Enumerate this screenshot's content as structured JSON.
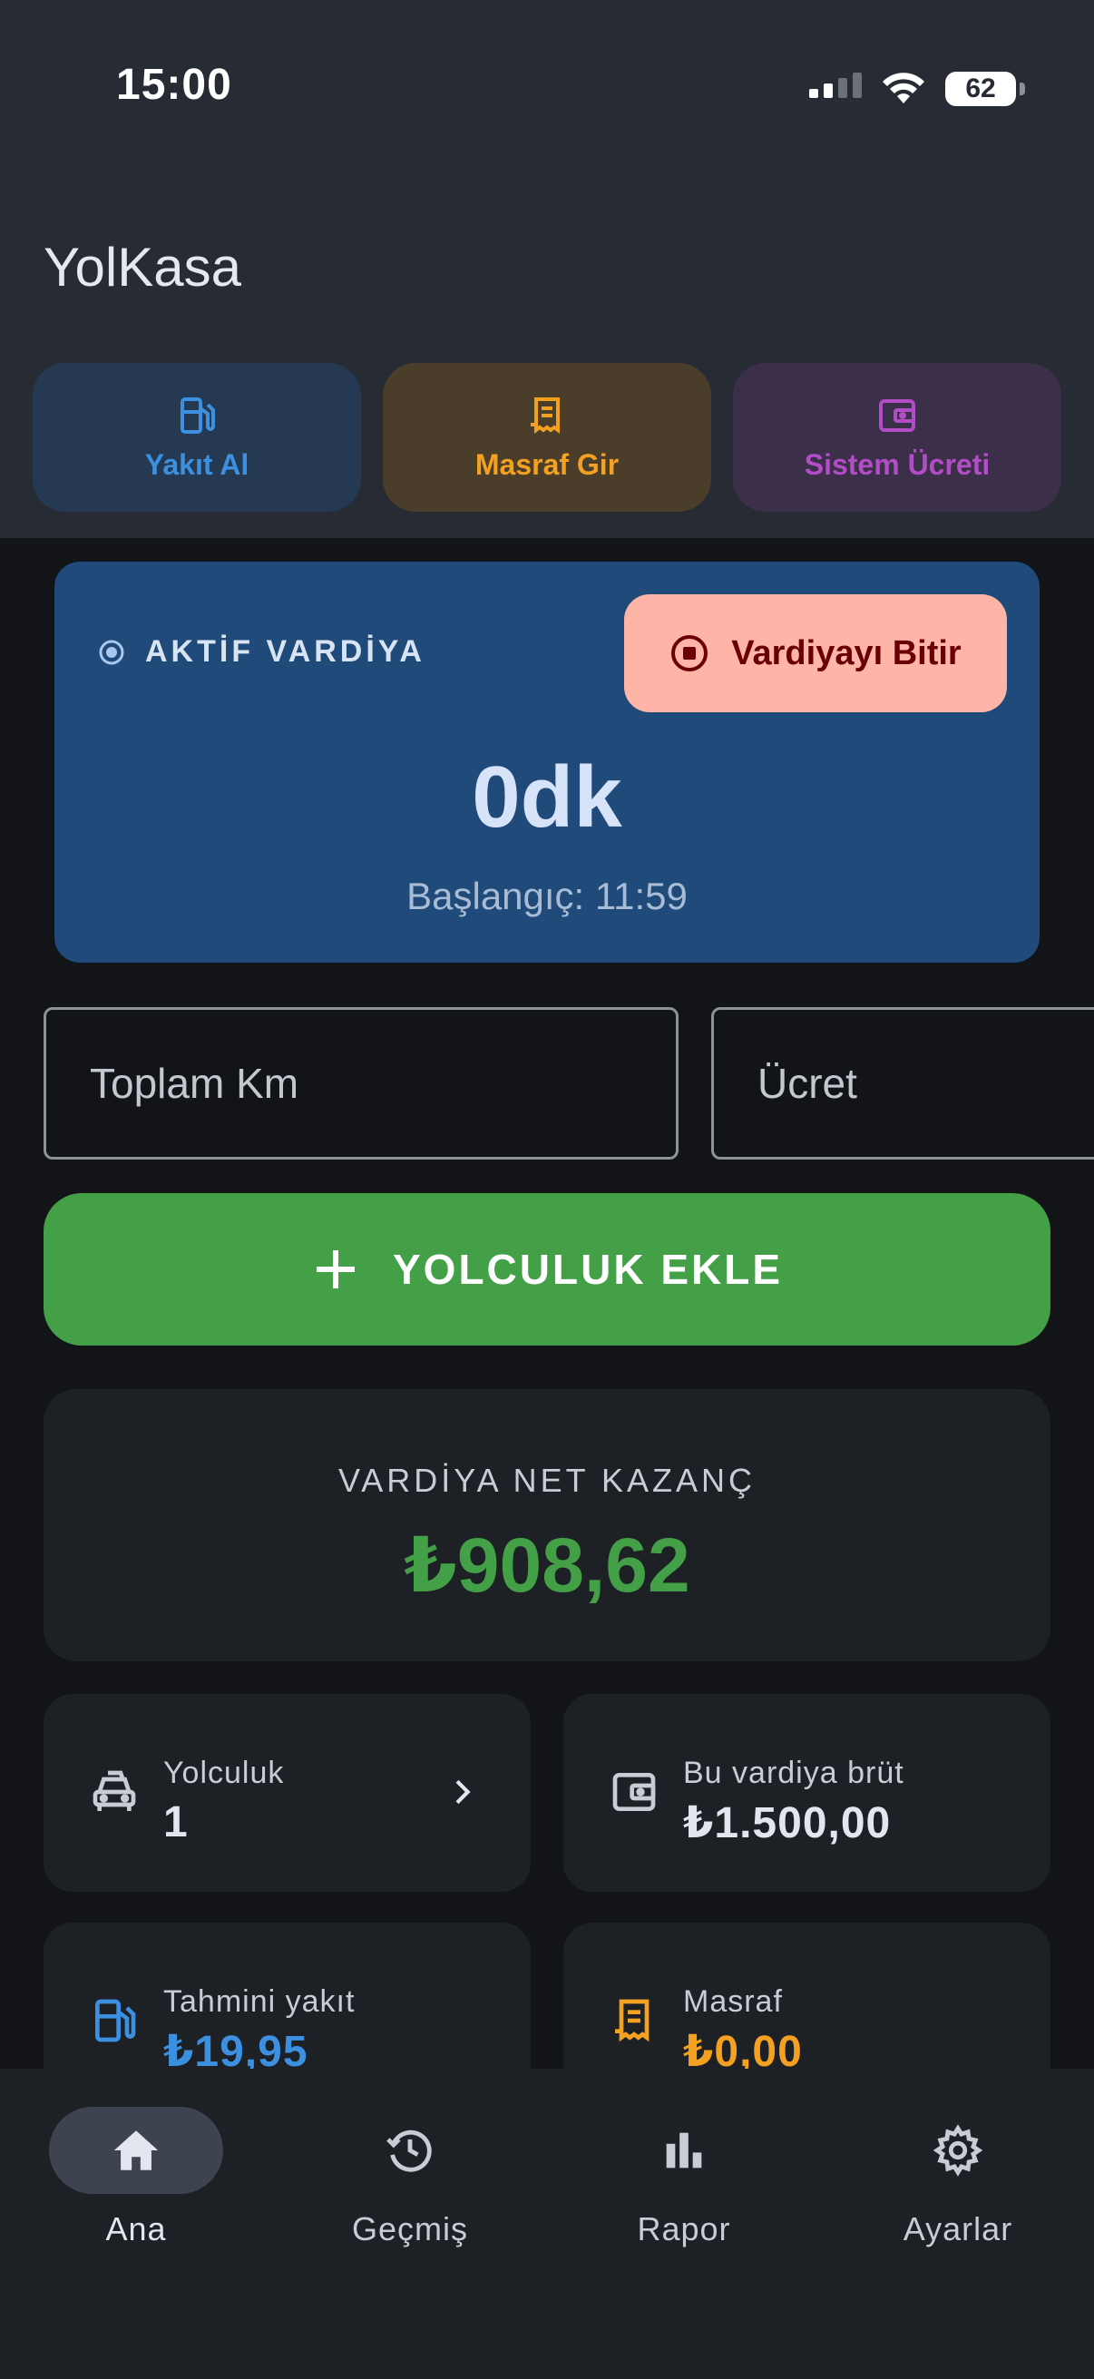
{
  "status_bar": {
    "time": "15:00",
    "battery": "62"
  },
  "app": {
    "title": "YolKasa"
  },
  "quick_actions": {
    "fuel": "Yakıt Al",
    "expense": "Masraf Gir",
    "system_fee": "Sistem Ücreti"
  },
  "shift": {
    "label": "AKTİF VARDİYA",
    "end_button": "Vardiyayı Bitir",
    "duration": "0dk",
    "start": "Başlangıç: 11:59"
  },
  "inputs": {
    "total_km_placeholder": "Toplam Km",
    "fare_placeholder": "Ücret"
  },
  "add_ride_button": "YOLCULUK EKLE",
  "net_earnings": {
    "label": "VARDİYA NET KAZANÇ",
    "value": "₺908,62"
  },
  "stats": {
    "rides": {
      "label": "Yolculuk",
      "value": "1"
    },
    "gross": {
      "label": "Bu vardiya brüt",
      "value": "₺1.500,00"
    },
    "fuel": {
      "label": "Tahmini yakıt",
      "value": "₺19,95"
    },
    "expense": {
      "label": "Masraf",
      "value": "₺0,00"
    }
  },
  "nav": {
    "home": "Ana",
    "history": "Geçmiş",
    "report": "Rapor",
    "settings": "Ayarlar"
  },
  "colors": {
    "primary_blue": "#3d8fe0",
    "expense_orange": "#f4a020",
    "system_purple": "#b24cc7",
    "success_green": "#43a047",
    "shift_card": "#1f4a7a",
    "end_button": "#ffb4a8"
  }
}
